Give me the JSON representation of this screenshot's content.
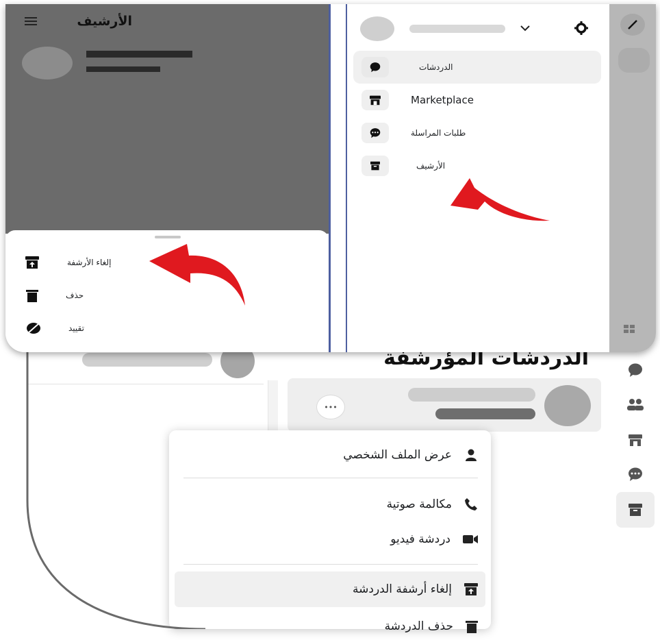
{
  "top_left_panel": {
    "title": "الأرشيف",
    "menu_icon": "hamburger-icon",
    "sheet_items": [
      {
        "label": "إلغاء الأرشفة",
        "icon": "unarchive-icon"
      },
      {
        "label": "حذف",
        "icon": "trash-icon"
      },
      {
        "label": "تقييد",
        "icon": "restrict-icon"
      }
    ]
  },
  "top_right_panel": {
    "settings_icon": "gear-icon",
    "chevron_icon": "chevron-down-icon",
    "nav_items": [
      {
        "label": "الدردشات",
        "icon": "chat-bubble-icon"
      },
      {
        "label": "Marketplace",
        "icon": "storefront-icon"
      },
      {
        "label": "طلبات المراسلة",
        "icon": "message-request-icon"
      },
      {
        "label": "الأرشيف",
        "icon": "archive-icon"
      }
    ],
    "edit_icon": "pencil-icon"
  },
  "archived_view": {
    "title": "الدردشات المؤرشفة",
    "more_label": "•••"
  },
  "context_menu": {
    "items": [
      {
        "label": "عرض الملف الشخصي",
        "icon": "person-icon"
      },
      {
        "label": "مكالمة صوتية",
        "icon": "phone-icon"
      },
      {
        "label": "دردشة فيديو",
        "icon": "video-icon"
      },
      {
        "label": "إلغاء أرشفة الدردشة",
        "icon": "unarchive-icon"
      },
      {
        "label": "حذف الدردشة",
        "icon": "trash-icon"
      }
    ]
  },
  "colors": {
    "arrow": "#e0191f",
    "dark_overlay": "#6b6b6b",
    "highlight": "#f0f0f0",
    "rail_gray": "#b7b7b7"
  }
}
